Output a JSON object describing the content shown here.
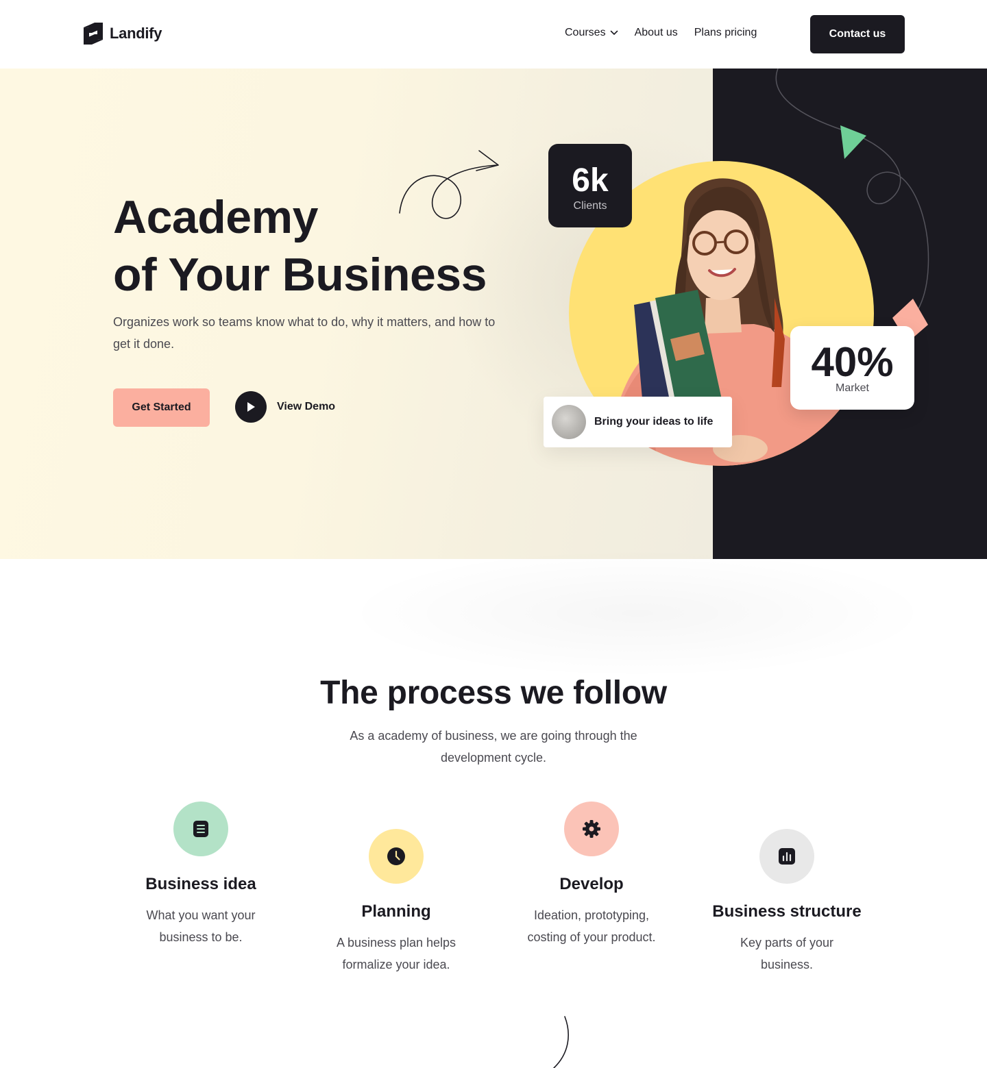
{
  "brand": {
    "name": "Landify"
  },
  "nav": {
    "links": [
      {
        "label": "Courses",
        "has_dropdown": true
      },
      {
        "label": "About us"
      },
      {
        "label": "Plans pricing"
      }
    ],
    "cta": "Contact us"
  },
  "hero": {
    "title_line1": "Academy",
    "title_line2": "of Your Business",
    "subtitle": "Organizes work so teams know what to do, why it matters, and how to get it done.",
    "primary_button": "Get Started",
    "demo_button": "View Demo",
    "stat_clients": {
      "value": "6k",
      "label": "Clients"
    },
    "stat_market": {
      "value": "40%",
      "label": "Market"
    },
    "card_text": "Bring your ideas to life"
  },
  "process": {
    "title": "The process we follow",
    "subtitle": "As a academy of business, we are going through the development cycle.",
    "steps": [
      {
        "icon": "document-icon",
        "title": "Business idea",
        "description": "What you want your business to be.",
        "color": "#b3e2c7"
      },
      {
        "icon": "clock-icon",
        "title": "Planning",
        "description": "A business plan helps formalize your idea.",
        "color": "#ffe89b"
      },
      {
        "icon": "gear-icon",
        "title": "Develop",
        "description": "Ideation, prototyping, costing of your product.",
        "color": "#fbc3b7"
      },
      {
        "icon": "bar-chart-icon",
        "title": "Business structure",
        "description": "Key parts of your business.",
        "color": "#e8e8e8"
      }
    ]
  },
  "colors": {
    "dark": "#1b1a21",
    "accent_peach": "#fbaf9f",
    "accent_yellow": "#ffe174",
    "accent_green": "#6fcf97",
    "hero_cream": "#fef8e2"
  }
}
